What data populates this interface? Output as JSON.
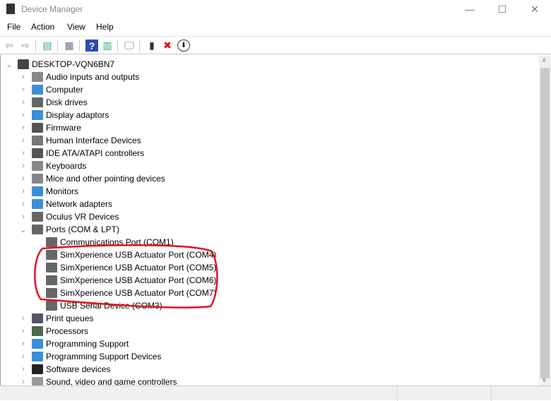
{
  "window": {
    "title": "Device Manager",
    "minimize": "—",
    "maximize": "☐",
    "close": "✕"
  },
  "menu": [
    "File",
    "Action",
    "View",
    "Help"
  ],
  "toolbar": [
    {
      "icon": "back-icon",
      "glyph": "⇦"
    },
    {
      "icon": "forward-icon",
      "glyph": "⇨"
    },
    {
      "icon": "show-hide-tree-icon",
      "glyph": "▤"
    },
    {
      "icon": "properties-icon",
      "glyph": "▦"
    },
    {
      "icon": "help-icon",
      "glyph": "?"
    },
    {
      "icon": "run-view-icon",
      "glyph": "▥"
    },
    {
      "icon": "scan-hardware-icon",
      "glyph": "🖵"
    },
    {
      "icon": "update-driver-icon",
      "glyph": "▮"
    },
    {
      "icon": "uninstall-icon",
      "glyph": "✖"
    },
    {
      "icon": "disable-icon",
      "glyph": "⬇"
    }
  ],
  "tree": {
    "root": "DESKTOP-VQN6BN7",
    "categories_before": [
      "Audio inputs and outputs",
      "Computer",
      "Disk drives",
      "Display adaptors",
      "Firmware",
      "Human Interface Devices",
      "IDE ATA/ATAPI controllers",
      "Keyboards",
      "Mice and other pointing devices",
      "Monitors",
      "Network adapters",
      "Oculus VR Devices"
    ],
    "expanded": "Ports (COM & LPT)",
    "ports": [
      "Communications Port (COM1)",
      "SimXperience USB Actuator Port (COM4)",
      "SimXperience USB Actuator Port (COM5)",
      "SimXperience USB Actuator Port (COM6)",
      "SimXperience USB Actuator Port (COM7)",
      "USB Serial Device (COM3)"
    ],
    "categories_after": [
      "Print queues",
      "Processors",
      "Programming Support",
      "Programming Support Devices",
      "Software devices",
      "Sound, video and game controllers"
    ]
  },
  "colors": {
    "annotation": "#e0141e"
  }
}
